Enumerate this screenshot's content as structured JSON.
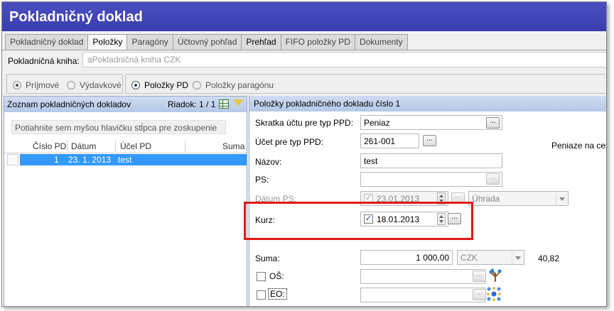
{
  "window": {
    "title": "Pokladničný doklad"
  },
  "tabs": [
    {
      "label": "Pokladničný doklad"
    },
    {
      "label": "Položky"
    },
    {
      "label": "Paragóny"
    },
    {
      "label": "Účtovný pohľad"
    },
    {
      "label": "Prehľad"
    },
    {
      "label": "FIFO položky PD"
    },
    {
      "label": "Dokumenty"
    }
  ],
  "kniha": {
    "label": "Pokladničná kniha:",
    "value": "aPokladničná kniha CZK"
  },
  "radios1": [
    {
      "label": "Príjmové",
      "selected": true
    },
    {
      "label": "Výdavkové",
      "selected": false
    }
  ],
  "radios2": [
    {
      "label": "Položky PD",
      "selected": true
    },
    {
      "label": "Položky paragónu",
      "selected": false
    }
  ],
  "left": {
    "title": "Zoznam pokladničných dokladov",
    "riadok": "Riadok: 1 / 1",
    "group_hint": "Potiahnite sem myšou hlavičku stĺpca pre zoskupenie",
    "columns": [
      "Číslo PD",
      "Dátum",
      "Účel PD",
      "Suma"
    ],
    "rows": [
      {
        "cislo": "1",
        "datum": "23. 1. 2013",
        "ucel": "test",
        "suma": ""
      }
    ]
  },
  "right": {
    "title": "Položky pokladničného dokladu číslo 1",
    "skratka": {
      "label": "Skratka účtu pre typ PPD:",
      "value": "Peniaz",
      "button": "..."
    },
    "ucet": {
      "label": "Účet pre typ PPD:",
      "value": "261-001",
      "button": "...",
      "description": "Peniaze na ceste"
    },
    "nazov": {
      "label": "Názov:",
      "value": "test"
    },
    "ps": {
      "label": "PS:",
      "value": "",
      "button": "..."
    },
    "datum_ps": {
      "label": "Dátum PS:",
      "value": "23.01.2013",
      "checked": true,
      "button": "...",
      "combo": "Úhrada"
    },
    "kurz": {
      "label": "Kurz:",
      "value": "18.01.2013",
      "checked": true,
      "button": "..."
    },
    "suma": {
      "label": "Suma:",
      "value": "1 000,00",
      "currency": "CZK",
      "converted": "40,82"
    },
    "os": {
      "label": "OŠ:",
      "value": "",
      "button": "..."
    },
    "eo": {
      "label": "EO:",
      "value": "",
      "button": "..."
    }
  },
  "colors": {
    "title_bar": "#3a3db0",
    "header_gradient": "#b5c8e8",
    "selection": "#3399ff",
    "highlight": "#e01818"
  },
  "icons": [
    "grid-icon",
    "filter-icon",
    "tree-structure-icon",
    "org-units-icon"
  ]
}
